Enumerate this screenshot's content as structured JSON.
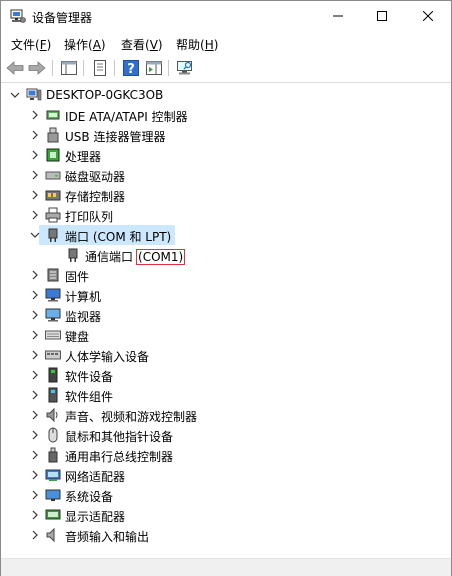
{
  "window": {
    "title": "设备管理器"
  },
  "menu": [
    {
      "label": "文件(",
      "acc": "F",
      "end": ")"
    },
    {
      "label": "操作(",
      "acc": "A",
      "end": ")"
    },
    {
      "label": "查看(",
      "acc": "V",
      "end": ")"
    },
    {
      "label": "帮助(",
      "acc": "H",
      "end": ")"
    }
  ],
  "tree": {
    "root": "DESKTOP-0GKC3OB",
    "items": [
      {
        "label": "IDE ATA/ATAPI 控制器",
        "icon": "ide-controller-icon"
      },
      {
        "label": "USB 连接器管理器",
        "icon": "usb-connector-icon"
      },
      {
        "label": "处理器",
        "icon": "processor-icon"
      },
      {
        "label": "磁盘驱动器",
        "icon": "disk-drive-icon"
      },
      {
        "label": "存储控制器",
        "icon": "storage-controller-icon"
      },
      {
        "label": "打印队列",
        "icon": "printer-icon"
      },
      {
        "label": "端口 (COM 和 LPT)",
        "icon": "port-icon"
      },
      {
        "label": "固件",
        "icon": "firmware-icon"
      },
      {
        "label": "计算机",
        "icon": "computer-icon"
      },
      {
        "label": "监视器",
        "icon": "monitor-icon"
      },
      {
        "label": "键盘",
        "icon": "keyboard-icon"
      },
      {
        "label": "人体学输入设备",
        "icon": "hid-icon"
      },
      {
        "label": "软件设备",
        "icon": "software-device-icon"
      },
      {
        "label": "软件组件",
        "icon": "software-component-icon"
      },
      {
        "label": "声音、视频和游戏控制器",
        "icon": "sound-icon"
      },
      {
        "label": "鼠标和其他指针设备",
        "icon": "mouse-icon"
      },
      {
        "label": "通用串行总线控制器",
        "icon": "usb-controller-icon"
      },
      {
        "label": "网络适配器",
        "icon": "network-adapter-icon"
      },
      {
        "label": "系统设备",
        "icon": "system-device-icon"
      },
      {
        "label": "显示适配器",
        "icon": "display-adapter-icon"
      },
      {
        "label": "音频输入和输出",
        "icon": "audio-io-icon"
      }
    ],
    "port_child": {
      "label": "通信端口",
      "com": "(COM1)"
    }
  },
  "colors": {
    "selection": "#cce8ff",
    "highlight_border": "#e0303a"
  }
}
